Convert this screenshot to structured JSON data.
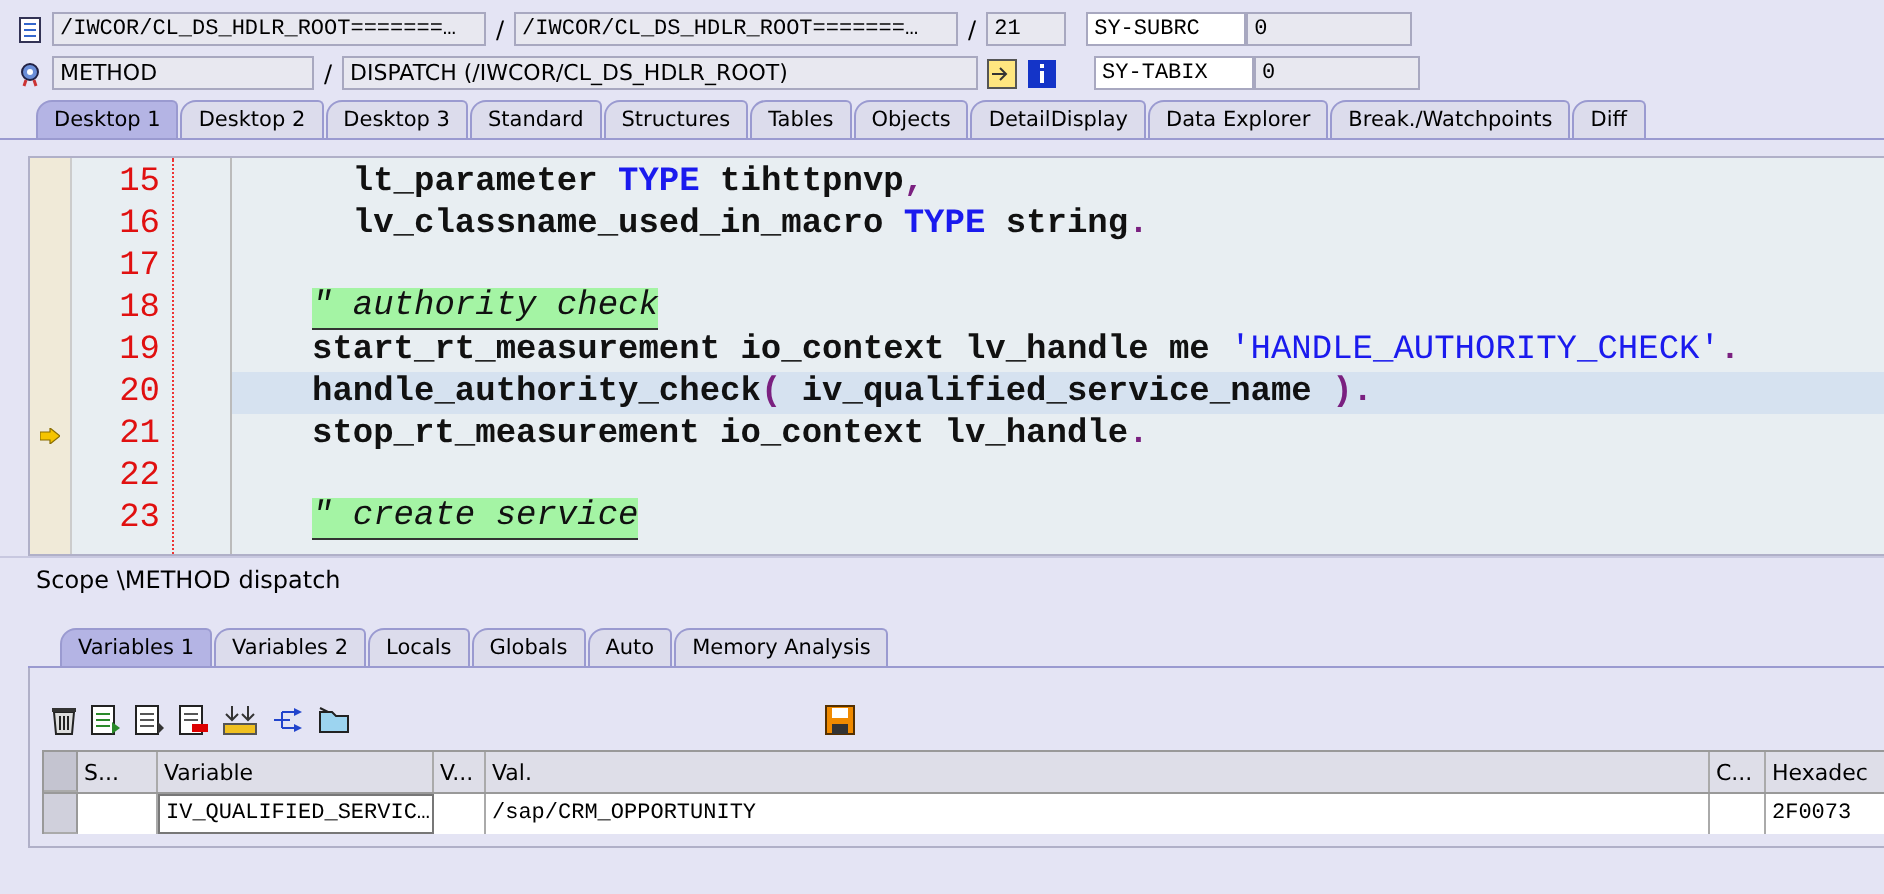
{
  "header": {
    "row_1": {
      "program": "/IWCOR/CL_DS_HDLR_ROOT=======…",
      "include": "/IWCOR/CL_DS_HDLR_ROOT=======…",
      "line": "21",
      "sysvar": "SY-SUBRC",
      "sysvalue": "0"
    },
    "row_2": {
      "event_type": "METHOD",
      "event": "DISPATCH (/IWCOR/CL_DS_HDLR_ROOT)",
      "sysvar": "SY-TABIX",
      "sysvalue": "0"
    },
    "separators": [
      "/",
      "/",
      "/"
    ]
  },
  "desktop_tabs": [
    {
      "label": "Desktop 1",
      "selected": true
    },
    {
      "label": "Desktop 2",
      "selected": false
    },
    {
      "label": "Desktop 3",
      "selected": false
    },
    {
      "label": "Standard",
      "selected": false
    },
    {
      "label": "Structures",
      "selected": false
    },
    {
      "label": "Tables",
      "selected": false
    },
    {
      "label": "Objects",
      "selected": false
    },
    {
      "label": "DetailDisplay",
      "selected": false
    },
    {
      "label": "Data Explorer",
      "selected": false
    },
    {
      "label": "Break./Watchpoints",
      "selected": false
    },
    {
      "label": "Diff",
      "selected": false
    }
  ],
  "code": {
    "lines": [
      {
        "number": "15",
        "current": false,
        "selected": false,
        "segments": [
          {
            "kind": "plain",
            "text": "  lt_parameter "
          },
          {
            "kind": "keyword",
            "text": "TYPE"
          },
          {
            "kind": "plain",
            "text": " tihttpnvp"
          },
          {
            "kind": "punct",
            "text": ","
          }
        ]
      },
      {
        "number": "16",
        "current": false,
        "selected": false,
        "segments": [
          {
            "kind": "plain",
            "text": "  lv_classname_used_in_macro "
          },
          {
            "kind": "keyword",
            "text": "TYPE"
          },
          {
            "kind": "plain",
            "text": " string"
          },
          {
            "kind": "punct",
            "text": "."
          }
        ]
      },
      {
        "number": "17",
        "current": false,
        "selected": false
      },
      {
        "number": "18",
        "current": false,
        "selected": false,
        "segments": [
          {
            "kind": "comment",
            "text": "\" authority check"
          }
        ]
      },
      {
        "number": "19",
        "current": false,
        "selected": false,
        "segments": [
          {
            "kind": "plain",
            "text": "start_rt_measurement io_context lv_handle me "
          },
          {
            "kind": "string",
            "text": "'HANDLE_AUTHORITY_CHECK'"
          },
          {
            "kind": "punct",
            "text": "."
          }
        ]
      },
      {
        "number": "20",
        "current": false,
        "selected": true,
        "segments": [
          {
            "kind": "plain",
            "text": "handle_authority_check"
          },
          {
            "kind": "punct",
            "text": "("
          },
          {
            "kind": "plain",
            "text": " iv_qualified_service_name "
          },
          {
            "kind": "punct",
            "text": ")."
          }
        ]
      },
      {
        "number": "21",
        "current": true,
        "selected": false,
        "segments": [
          {
            "kind": "plain",
            "text": "stop_rt_measurement io_context lv_handle"
          },
          {
            "kind": "punct",
            "text": "."
          }
        ]
      },
      {
        "number": "22",
        "current": false,
        "selected": false
      },
      {
        "number": "23",
        "current": false,
        "selected": false,
        "segments": [
          {
            "kind": "comment",
            "text": "\" create service"
          }
        ]
      }
    ]
  },
  "scope": "Scope \\METHOD dispatch",
  "variable_tabs": [
    {
      "label": "Variables 1",
      "selected": true
    },
    {
      "label": "Variables 2",
      "selected": false
    },
    {
      "label": "Locals",
      "selected": false
    },
    {
      "label": "Globals",
      "selected": false
    },
    {
      "label": "Auto",
      "selected": false
    },
    {
      "label": "Memory Analysis",
      "selected": false
    }
  ],
  "table": {
    "columns": [
      "S...",
      "Variable",
      "V...",
      "Val.",
      "C...",
      "Hexadec"
    ],
    "rows": [
      {
        "cells": [
          "",
          "IV_QUALIFIED_SERVIC…",
          "",
          "/sap/CRM_OPPORTUNITY",
          "",
          "2F0073"
        ]
      }
    ]
  }
}
